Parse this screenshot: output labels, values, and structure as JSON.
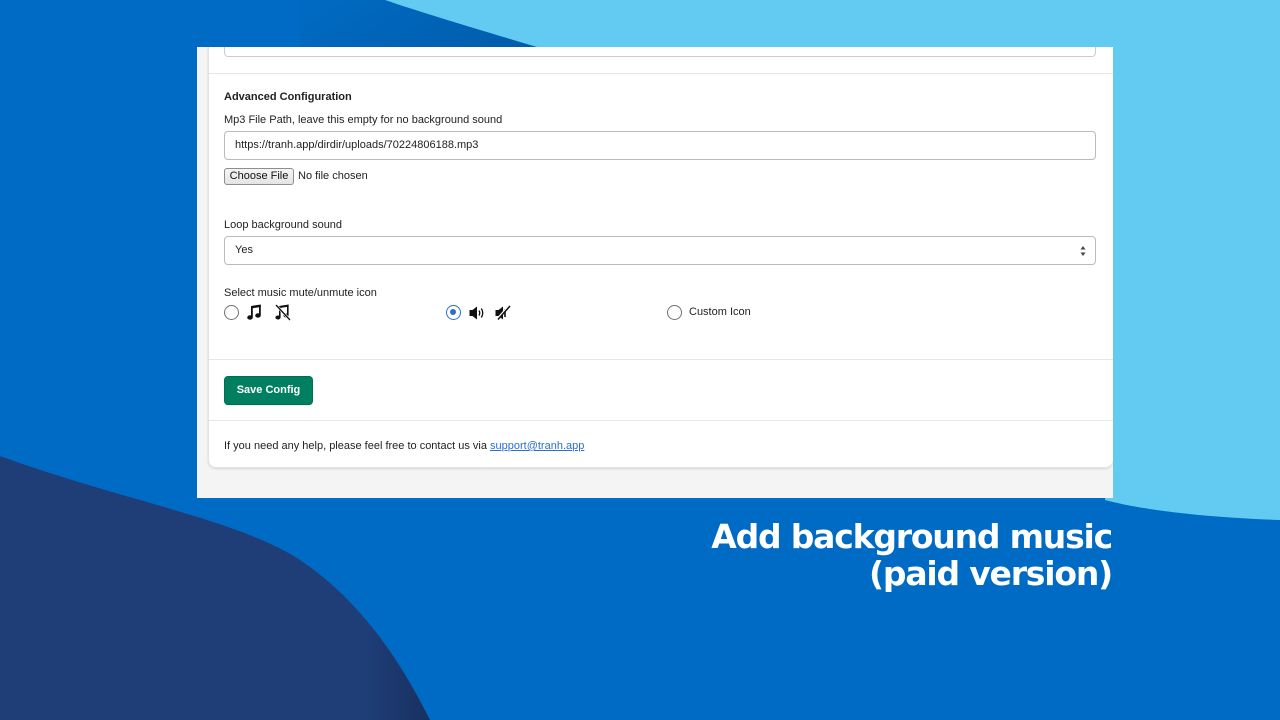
{
  "theme": {
    "background_blue": "#006bc4",
    "light_blue": "#63cbf2",
    "navy": "#1f3e78",
    "save_button_green": "#008060",
    "link_blue": "#2c6ecb",
    "radio_blue": "#2c6ecb"
  },
  "form": {
    "section_title": "Advanced Configuration",
    "mp3_path": {
      "label": "Mp3 File Path, leave this empty for no background sound",
      "value": "https://tranh.app/dirdir/uploads/70224806188.mp3"
    },
    "file_picker": {
      "button_label": "Choose File",
      "status": "No file chosen"
    },
    "loop": {
      "label": "Loop background sound",
      "selected": "Yes"
    },
    "icon_choice": {
      "label": "Select music mute/unmute icon",
      "options": [
        {
          "id": "music-note",
          "icons": [
            "music-note-icon",
            "music-note-muted-icon"
          ],
          "checked": false
        },
        {
          "id": "speaker",
          "icons": [
            "speaker-icon",
            "speaker-muted-icon"
          ],
          "checked": true
        },
        {
          "id": "custom",
          "label": "Custom Icon",
          "checked": false
        }
      ]
    },
    "save_button_label": "Save Config"
  },
  "help": {
    "text": "If you need any help, please feel free to contact us via ",
    "link_text": "support@tranh.app"
  },
  "caption": {
    "line1": "Add background music",
    "line2": "(paid version)"
  }
}
